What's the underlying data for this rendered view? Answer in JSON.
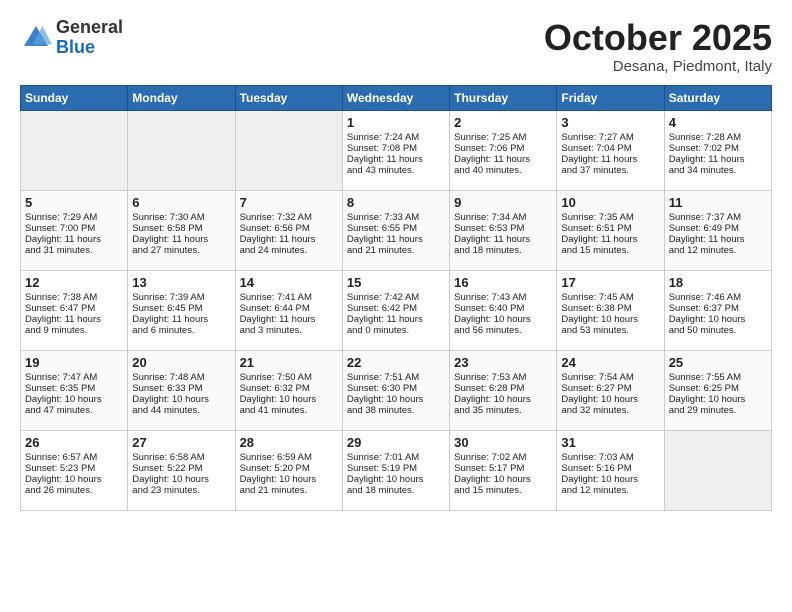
{
  "logo": {
    "general": "General",
    "blue": "Blue"
  },
  "title": "October 2025",
  "location": "Desana, Piedmont, Italy",
  "days_of_week": [
    "Sunday",
    "Monday",
    "Tuesday",
    "Wednesday",
    "Thursday",
    "Friday",
    "Saturday"
  ],
  "weeks": [
    [
      {
        "day": "",
        "empty": true
      },
      {
        "day": "",
        "empty": true
      },
      {
        "day": "",
        "empty": true
      },
      {
        "day": "1",
        "lines": [
          "Sunrise: 7:24 AM",
          "Sunset: 7:08 PM",
          "Daylight: 11 hours",
          "and 43 minutes."
        ]
      },
      {
        "day": "2",
        "lines": [
          "Sunrise: 7:25 AM",
          "Sunset: 7:06 PM",
          "Daylight: 11 hours",
          "and 40 minutes."
        ]
      },
      {
        "day": "3",
        "lines": [
          "Sunrise: 7:27 AM",
          "Sunset: 7:04 PM",
          "Daylight: 11 hours",
          "and 37 minutes."
        ]
      },
      {
        "day": "4",
        "lines": [
          "Sunrise: 7:28 AM",
          "Sunset: 7:02 PM",
          "Daylight: 11 hours",
          "and 34 minutes."
        ]
      }
    ],
    [
      {
        "day": "5",
        "lines": [
          "Sunrise: 7:29 AM",
          "Sunset: 7:00 PM",
          "Daylight: 11 hours",
          "and 31 minutes."
        ]
      },
      {
        "day": "6",
        "lines": [
          "Sunrise: 7:30 AM",
          "Sunset: 6:58 PM",
          "Daylight: 11 hours",
          "and 27 minutes."
        ]
      },
      {
        "day": "7",
        "lines": [
          "Sunrise: 7:32 AM",
          "Sunset: 6:56 PM",
          "Daylight: 11 hours",
          "and 24 minutes."
        ]
      },
      {
        "day": "8",
        "lines": [
          "Sunrise: 7:33 AM",
          "Sunset: 6:55 PM",
          "Daylight: 11 hours",
          "and 21 minutes."
        ]
      },
      {
        "day": "9",
        "lines": [
          "Sunrise: 7:34 AM",
          "Sunset: 6:53 PM",
          "Daylight: 11 hours",
          "and 18 minutes."
        ]
      },
      {
        "day": "10",
        "lines": [
          "Sunrise: 7:35 AM",
          "Sunset: 6:51 PM",
          "Daylight: 11 hours",
          "and 15 minutes."
        ]
      },
      {
        "day": "11",
        "lines": [
          "Sunrise: 7:37 AM",
          "Sunset: 6:49 PM",
          "Daylight: 11 hours",
          "and 12 minutes."
        ]
      }
    ],
    [
      {
        "day": "12",
        "lines": [
          "Sunrise: 7:38 AM",
          "Sunset: 6:47 PM",
          "Daylight: 11 hours",
          "and 9 minutes."
        ]
      },
      {
        "day": "13",
        "lines": [
          "Sunrise: 7:39 AM",
          "Sunset: 6:45 PM",
          "Daylight: 11 hours",
          "and 6 minutes."
        ]
      },
      {
        "day": "14",
        "lines": [
          "Sunrise: 7:41 AM",
          "Sunset: 6:44 PM",
          "Daylight: 11 hours",
          "and 3 minutes."
        ]
      },
      {
        "day": "15",
        "lines": [
          "Sunrise: 7:42 AM",
          "Sunset: 6:42 PM",
          "Daylight: 11 hours",
          "and 0 minutes."
        ]
      },
      {
        "day": "16",
        "lines": [
          "Sunrise: 7:43 AM",
          "Sunset: 6:40 PM",
          "Daylight: 10 hours",
          "and 56 minutes."
        ]
      },
      {
        "day": "17",
        "lines": [
          "Sunrise: 7:45 AM",
          "Sunset: 6:38 PM",
          "Daylight: 10 hours",
          "and 53 minutes."
        ]
      },
      {
        "day": "18",
        "lines": [
          "Sunrise: 7:46 AM",
          "Sunset: 6:37 PM",
          "Daylight: 10 hours",
          "and 50 minutes."
        ]
      }
    ],
    [
      {
        "day": "19",
        "lines": [
          "Sunrise: 7:47 AM",
          "Sunset: 6:35 PM",
          "Daylight: 10 hours",
          "and 47 minutes."
        ]
      },
      {
        "day": "20",
        "lines": [
          "Sunrise: 7:48 AM",
          "Sunset: 6:33 PM",
          "Daylight: 10 hours",
          "and 44 minutes."
        ]
      },
      {
        "day": "21",
        "lines": [
          "Sunrise: 7:50 AM",
          "Sunset: 6:32 PM",
          "Daylight: 10 hours",
          "and 41 minutes."
        ]
      },
      {
        "day": "22",
        "lines": [
          "Sunrise: 7:51 AM",
          "Sunset: 6:30 PM",
          "Daylight: 10 hours",
          "and 38 minutes."
        ]
      },
      {
        "day": "23",
        "lines": [
          "Sunrise: 7:53 AM",
          "Sunset: 6:28 PM",
          "Daylight: 10 hours",
          "and 35 minutes."
        ]
      },
      {
        "day": "24",
        "lines": [
          "Sunrise: 7:54 AM",
          "Sunset: 6:27 PM",
          "Daylight: 10 hours",
          "and 32 minutes."
        ]
      },
      {
        "day": "25",
        "lines": [
          "Sunrise: 7:55 AM",
          "Sunset: 6:25 PM",
          "Daylight: 10 hours",
          "and 29 minutes."
        ]
      }
    ],
    [
      {
        "day": "26",
        "lines": [
          "Sunrise: 6:57 AM",
          "Sunset: 5:23 PM",
          "Daylight: 10 hours",
          "and 26 minutes."
        ]
      },
      {
        "day": "27",
        "lines": [
          "Sunrise: 6:58 AM",
          "Sunset: 5:22 PM",
          "Daylight: 10 hours",
          "and 23 minutes."
        ]
      },
      {
        "day": "28",
        "lines": [
          "Sunrise: 6:59 AM",
          "Sunset: 5:20 PM",
          "Daylight: 10 hours",
          "and 21 minutes."
        ]
      },
      {
        "day": "29",
        "lines": [
          "Sunrise: 7:01 AM",
          "Sunset: 5:19 PM",
          "Daylight: 10 hours",
          "and 18 minutes."
        ]
      },
      {
        "day": "30",
        "lines": [
          "Sunrise: 7:02 AM",
          "Sunset: 5:17 PM",
          "Daylight: 10 hours",
          "and 15 minutes."
        ]
      },
      {
        "day": "31",
        "lines": [
          "Sunrise: 7:03 AM",
          "Sunset: 5:16 PM",
          "Daylight: 10 hours",
          "and 12 minutes."
        ]
      },
      {
        "day": "",
        "empty": true
      }
    ]
  ]
}
